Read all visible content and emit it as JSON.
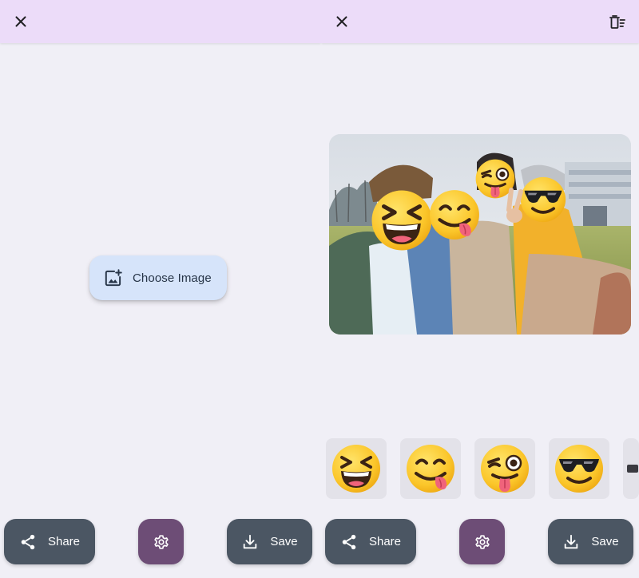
{
  "left_pane": {
    "choose_image_label": "Choose Image",
    "share_label": "Share",
    "save_label": "Save",
    "icons": {
      "close": "close-icon",
      "add_image": "add-photo-icon",
      "share": "share-icon",
      "settings": "gear-icon",
      "save": "download-icon"
    }
  },
  "right_pane": {
    "share_label": "Share",
    "save_label": "Save",
    "icons": {
      "close": "close-icon",
      "delete": "delete-sweep-icon",
      "share": "share-icon",
      "settings": "gear-icon",
      "save": "download-icon"
    },
    "photo": {
      "description": "",
      "face_emojis": [
        "grinning-squinting-face",
        "face-savoring-food",
        "winking-face-with-tongue",
        "smiling-face-with-sunglasses"
      ]
    },
    "emoji_picker": [
      {
        "name": "grinning-squinting-face"
      },
      {
        "name": "face-savoring-food"
      },
      {
        "name": "winking-face-with-tongue"
      },
      {
        "name": "smiling-face-with-sunglasses"
      },
      {
        "name": "partial-next-emoji"
      }
    ]
  },
  "colors": {
    "background": "#f0eff6",
    "top_bar": "#ecdcf9",
    "choose_button": "#d6e4fa",
    "action_button": "#4b5663",
    "settings_button": "#6d4d76",
    "emoji_tile": "#e3e2e9"
  }
}
